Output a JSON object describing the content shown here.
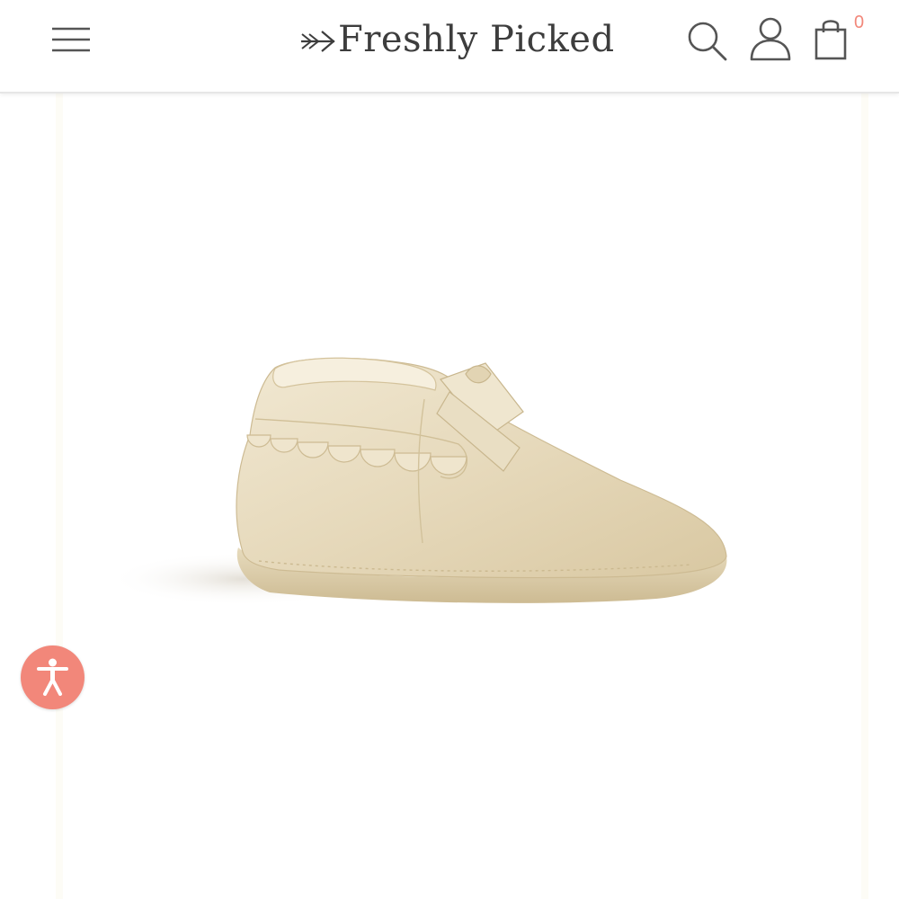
{
  "header": {
    "brand": "Freshly Picked",
    "cart_count": "0"
  },
  "icons": {
    "menu": "hamburger-menu-icon",
    "search": "search-icon",
    "account": "user-icon",
    "cart": "shopping-bag-icon",
    "accessibility": "accessibility-person-icon"
  },
  "colors": {
    "accent": "#f2877a",
    "text": "#3d3d3d",
    "icon": "#555555",
    "header_border": "#e6e6e6",
    "product_gold": "#e8dcc0"
  }
}
